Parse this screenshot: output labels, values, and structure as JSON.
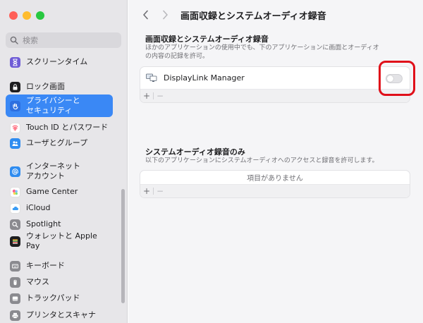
{
  "sidebar": {
    "search_placeholder": "検索",
    "items": [
      {
        "label": "スクリーンタイム",
        "icon": "hourglass-icon",
        "color": "#6e5bd6"
      },
      {
        "label": "ロック画面",
        "icon": "lock-icon",
        "color": "#1d1d1f"
      },
      {
        "label": "プライバシーと\nセキュリティ",
        "icon": "hand-icon",
        "color": "#3a88f5",
        "active": true
      },
      {
        "label": "Touch ID とパスワード",
        "icon": "fingerprint-icon",
        "color": "#ff6c7a"
      },
      {
        "label": "ユーザとグループ",
        "icon": "users-icon",
        "color": "#2f8cf0"
      },
      {
        "label": "インターネット\nアカウント",
        "icon": "at-icon",
        "color": "#2f8cf0"
      },
      {
        "label": "Game Center",
        "icon": "game-center-icon",
        "color": "#ffffff"
      },
      {
        "label": "iCloud",
        "icon": "cloud-icon",
        "color": "#ffffff"
      },
      {
        "label": "Spotlight",
        "icon": "magnifier-icon",
        "color": "#8a8a8f"
      },
      {
        "label": "ウォレットと Apple Pay",
        "icon": "wallet-icon",
        "color": "#1d1d1f"
      },
      {
        "label": "キーボード",
        "icon": "keyboard-icon",
        "color": "#8a8a8f"
      },
      {
        "label": "マウス",
        "icon": "mouse-icon",
        "color": "#8a8a8f"
      },
      {
        "label": "トラックパッド",
        "icon": "trackpad-icon",
        "color": "#8a8a8f"
      },
      {
        "label": "プリンタとスキャナ",
        "icon": "printer-icon",
        "color": "#8a8a8f"
      }
    ]
  },
  "main": {
    "title": "画面収録とシステムオーディオ録音",
    "section1": {
      "title": "画面収録とシステムオーディオ録音",
      "description": "ほかのアプリケーションの使用中でも、下のアプリケーションに画面とオーディオの内容の記録を許可。",
      "apps": [
        {
          "name": "DisplayLink Manager",
          "enabled": false
        }
      ],
      "add_label": "+",
      "remove_label": "−"
    },
    "section2": {
      "title": "システムオーディオ録音のみ",
      "description": "以下のアプリケーションにシステムオーディオへのアクセスと録音を許可します。",
      "empty_text": "項目がありません",
      "add_label": "+",
      "remove_label": "−"
    }
  },
  "colors": {
    "accent": "#3a88f5",
    "highlight": "#e0101a"
  }
}
